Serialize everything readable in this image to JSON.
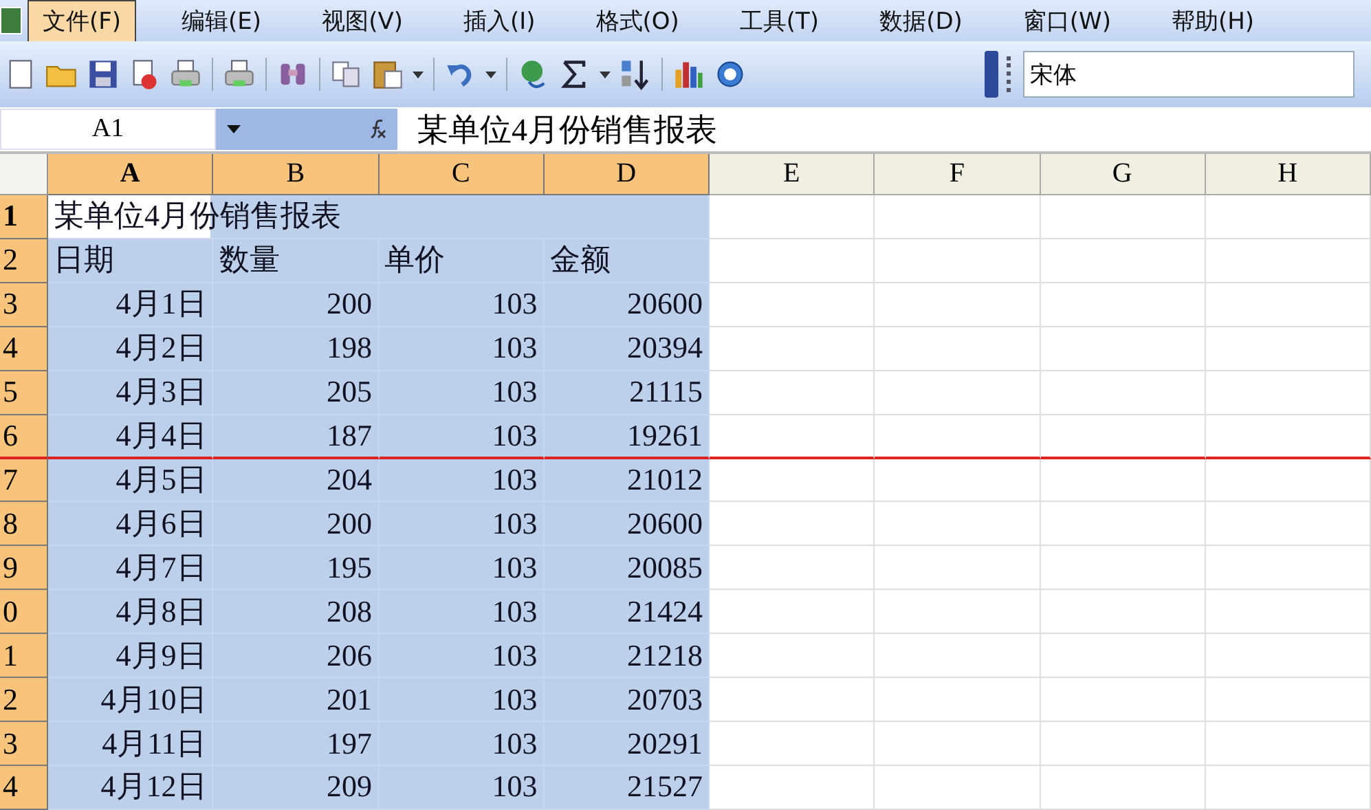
{
  "menu": [
    {
      "label": "文件(F)",
      "selected": true
    },
    {
      "label": "编辑(E)",
      "selected": false
    },
    {
      "label": "视图(V)",
      "selected": false
    },
    {
      "label": "插入(I)",
      "selected": false
    },
    {
      "label": "格式(O)",
      "selected": false
    },
    {
      "label": "工具(T)",
      "selected": false
    },
    {
      "label": "数据(D)",
      "selected": false
    },
    {
      "label": "窗口(W)",
      "selected": false
    },
    {
      "label": "帮助(H)",
      "selected": false
    }
  ],
  "font_box": {
    "value": "宋体"
  },
  "name_box": {
    "value": "A1"
  },
  "formula_bar": {
    "value": "某单位4月份销售报表"
  },
  "columns": [
    {
      "label": "A",
      "selected": true,
      "active": true
    },
    {
      "label": "B",
      "selected": true,
      "active": false
    },
    {
      "label": "C",
      "selected": true,
      "active": false
    },
    {
      "label": "D",
      "selected": true,
      "active": false
    },
    {
      "label": "E",
      "selected": false,
      "active": false
    },
    {
      "label": "F",
      "selected": false,
      "active": false
    },
    {
      "label": "G",
      "selected": false,
      "active": false
    },
    {
      "label": "H",
      "selected": false,
      "active": false
    }
  ],
  "rows": [
    {
      "header": "1",
      "selected": true,
      "active": true,
      "kind": "text",
      "cells": [
        "某单位4月份销售报表"
      ]
    },
    {
      "header": "2",
      "selected": true,
      "active": false,
      "kind": "text",
      "cells": [
        "日期",
        "数量",
        "单价",
        "金额"
      ]
    },
    {
      "header": "3",
      "selected": true,
      "active": false,
      "kind": "data",
      "cells": [
        "4月1日",
        "200",
        "103",
        "20600"
      ]
    },
    {
      "header": "4",
      "selected": true,
      "active": false,
      "kind": "data",
      "cells": [
        "4月2日",
        "198",
        "103",
        "20394"
      ]
    },
    {
      "header": "5",
      "selected": true,
      "active": false,
      "kind": "data",
      "cells": [
        "4月3日",
        "205",
        "103",
        "21115"
      ]
    },
    {
      "header": "6",
      "selected": true,
      "active": false,
      "kind": "data",
      "cells": [
        "4月4日",
        "187",
        "103",
        "19261"
      ]
    },
    {
      "header": "7",
      "selected": true,
      "active": false,
      "kind": "data",
      "cells": [
        "4月5日",
        "204",
        "103",
        "21012"
      ]
    },
    {
      "header": "8",
      "selected": true,
      "active": false,
      "kind": "data",
      "cells": [
        "4月6日",
        "200",
        "103",
        "20600"
      ]
    },
    {
      "header": "9",
      "selected": true,
      "active": false,
      "kind": "data",
      "cells": [
        "4月7日",
        "195",
        "103",
        "20085"
      ]
    },
    {
      "header": "0",
      "selected": true,
      "active": false,
      "kind": "data",
      "cells": [
        "4月8日",
        "208",
        "103",
        "21424"
      ]
    },
    {
      "header": "1",
      "selected": true,
      "active": false,
      "kind": "data",
      "cells": [
        "4月9日",
        "206",
        "103",
        "21218"
      ]
    },
    {
      "header": "2",
      "selected": true,
      "active": false,
      "kind": "data",
      "cells": [
        "4月10日",
        "201",
        "103",
        "20703"
      ]
    },
    {
      "header": "3",
      "selected": true,
      "active": false,
      "kind": "data",
      "cells": [
        "4月11日",
        "197",
        "103",
        "20291"
      ]
    },
    {
      "header": "4",
      "selected": true,
      "active": false,
      "kind": "data",
      "cells": [
        "4月12日",
        "209",
        "103",
        "21527"
      ]
    }
  ]
}
